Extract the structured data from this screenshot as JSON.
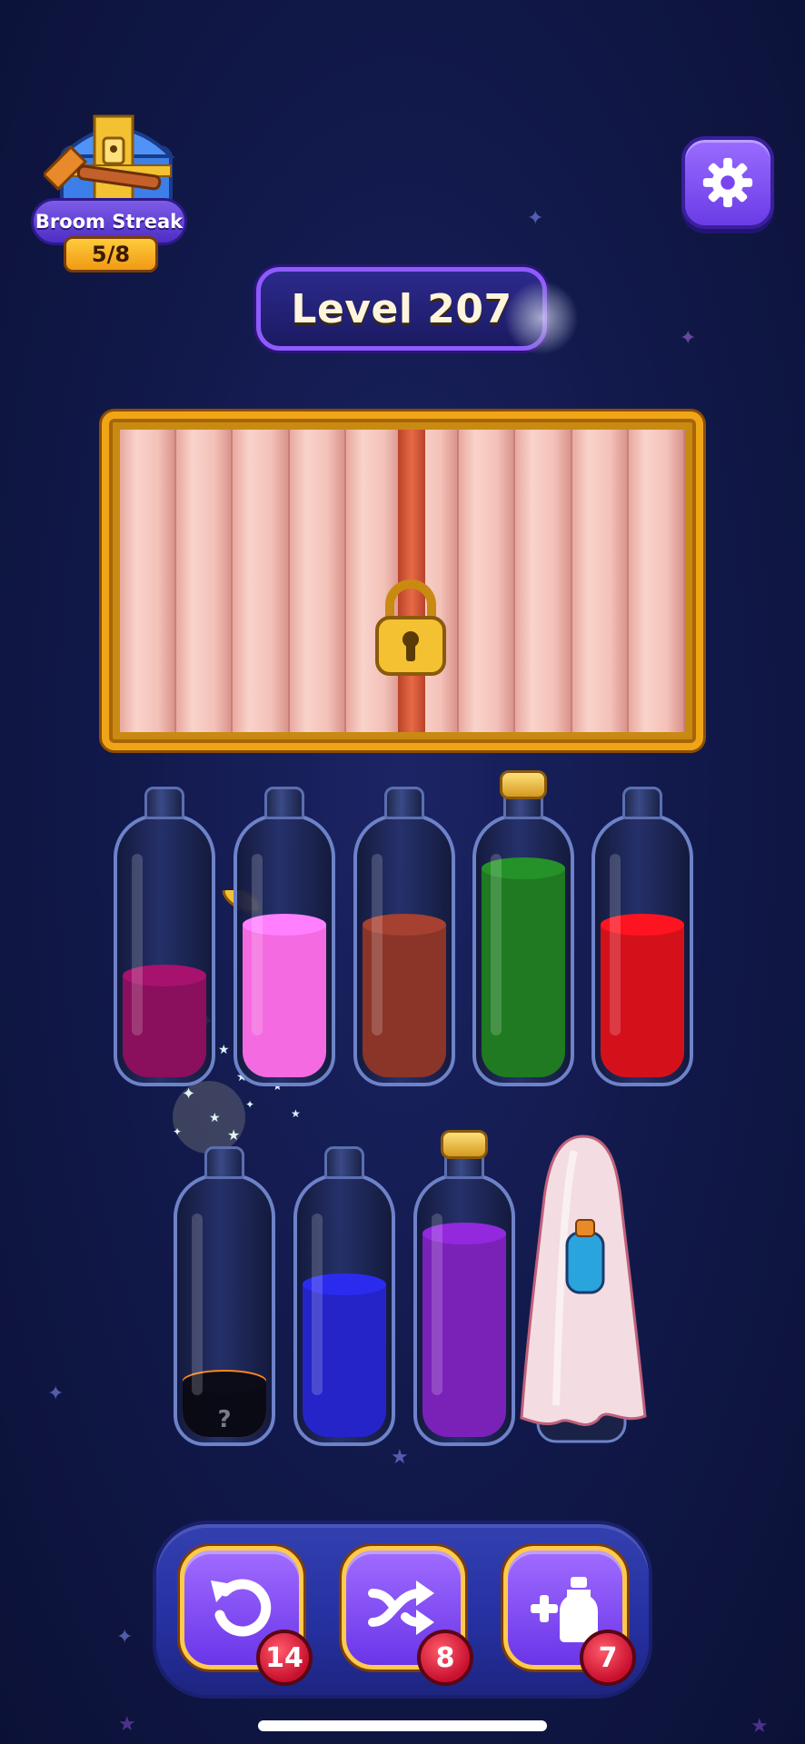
{
  "game": {
    "streak": {
      "title": "Broom Streak",
      "progress": "5/8",
      "icon": "treasure-chest-icon"
    },
    "level": {
      "label": "Level 207"
    },
    "settings": {
      "icon": "gear-icon"
    },
    "locked_crate": {
      "icon": "padlock-icon",
      "state": "locked"
    },
    "bottles_row1": [
      {
        "color": "#8a0f5c",
        "fill": 0.4,
        "corked": false
      },
      {
        "color": "#f46ae0",
        "fill": 0.6,
        "corked": false
      },
      {
        "color": "#8a3528",
        "fill": 0.6,
        "corked": false
      },
      {
        "color": "#1f7a22",
        "fill": 0.82,
        "corked": true
      },
      {
        "color": "#d4111b",
        "fill": 0.6,
        "corked": false
      }
    ],
    "bottles_row2": [
      {
        "color": "#f07016",
        "fill": 0.22,
        "corked": false,
        "mystery": "?"
      },
      {
        "color": "#2424c8",
        "fill": 0.6,
        "corked": false
      },
      {
        "color": "#7a22b8",
        "fill": 0.8,
        "corked": true
      },
      {
        "covered": true,
        "hint_color": "#2aa4dc"
      }
    ],
    "tools": [
      {
        "name": "undo",
        "icon": "undo-icon",
        "count": "14"
      },
      {
        "name": "shuffle",
        "icon": "shuffle-icon",
        "count": "8"
      },
      {
        "name": "add-bottle",
        "icon": "add-bottle-icon",
        "count": "7"
      }
    ]
  }
}
